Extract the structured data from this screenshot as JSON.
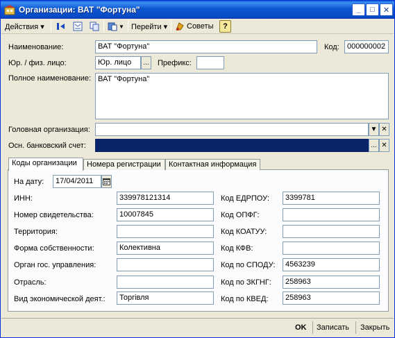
{
  "window": {
    "title": "Организации: ВАТ \"Фортуна\""
  },
  "titlebar_buttons": {
    "minimize": "_",
    "maximize": "□",
    "close": "✕"
  },
  "toolbar": {
    "actions_label": "Действия ▾",
    "goto_label": "Перейти ▾",
    "tips_label": "Советы",
    "help_label": "?"
  },
  "form": {
    "name_label": "Наименование:",
    "name_value": "ВАТ \"Фортуна\"",
    "code_label": "Код:",
    "code_value": "000000002",
    "entity_label": "Юр. / физ. лицо:",
    "entity_value": "Юр. лицо",
    "prefix_label": "Префикс:",
    "prefix_value": "",
    "fullname_label": "Полное наименование:",
    "fullname_value": "ВАТ \"Фортуна\"",
    "head_org_label": "Головная организация:",
    "head_org_value": "",
    "bank_label": "Осн. банковский счет:",
    "bank_value": ""
  },
  "tabs": [
    "Коды организации",
    "Номера регистрации",
    "Контактная информация"
  ],
  "codes": {
    "date_label": "На дату:",
    "date_value": "17/04/2011",
    "left": [
      {
        "label": "ИНН:",
        "value": "339978121314"
      },
      {
        "label": "Номер свидетельства:",
        "value": "10007845"
      },
      {
        "label": "Территория:",
        "value": ""
      },
      {
        "label": "Форма собственности:",
        "value": "Колективна"
      },
      {
        "label": "Орган гос. управления:",
        "value": ""
      },
      {
        "label": "Отрасль:",
        "value": ""
      },
      {
        "label": "Вид экономической деят.:",
        "value": "Торгівля"
      }
    ],
    "right": [
      {
        "label": "Код ЕДРПОУ:",
        "value": "3399781"
      },
      {
        "label": "Код ОПФГ:",
        "value": ""
      },
      {
        "label": "Код КОАТУУ:",
        "value": ""
      },
      {
        "label": "Код КФВ:",
        "value": ""
      },
      {
        "label": "Код по СПОДУ:",
        "value": "4563239"
      },
      {
        "label": "Код по ЗКГНГ:",
        "value": "258963"
      },
      {
        "label": "Код по КВЕД:",
        "value": "258963"
      }
    ]
  },
  "footer": {
    "ok": "OK",
    "save": "Записать",
    "close": "Закрыть"
  },
  "icons": {
    "select": "...",
    "clear": "✕",
    "dropdown": "▼",
    "app": "org-icon",
    "calendar": "calendar-icon"
  },
  "colors": {
    "accent": "#0a246a",
    "title_bar": "#0a5fd8"
  }
}
